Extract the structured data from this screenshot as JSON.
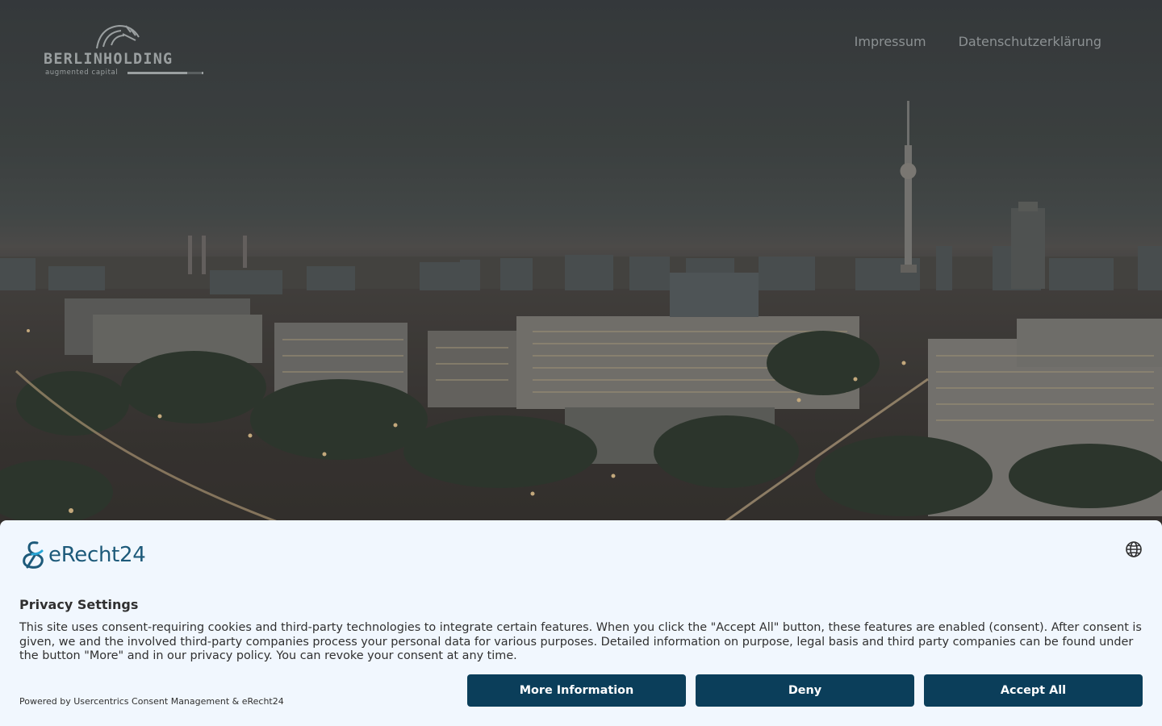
{
  "header": {
    "logo_wordmark": "BERLINHOLDING",
    "logo_tagline": "augmented capital",
    "nav": [
      {
        "label": "Impressum"
      },
      {
        "label": "Datenschutzerklärung"
      }
    ]
  },
  "hero": {
    "image": "berlin-skyline-at-dusk"
  },
  "consent": {
    "brand_name": "eRecht24",
    "language_icon": "globe-icon",
    "title": "Privacy Settings",
    "body": "This site uses consent-requiring cookies and third-party technologies to integrate certain features. When you click the \"Accept All\" button, these features are enabled (consent). After consent is given, we and the involved third-party companies process your personal data for various purposes. Detailed information on purpose, legal basis and third party companies can be found under the button \"More\" and in our privacy policy. You can revoke your consent at any time.",
    "powered_by": "Powered by Usercentrics Consent Management & eRecht24",
    "buttons": {
      "more": "More Information",
      "deny": "Deny",
      "accept": "Accept All"
    }
  },
  "colors": {
    "button_bg": "#0b3e5a",
    "banner_bg": "#f1f7fe",
    "brand": "#1d5a7a",
    "nav_text": "#8c9193"
  }
}
